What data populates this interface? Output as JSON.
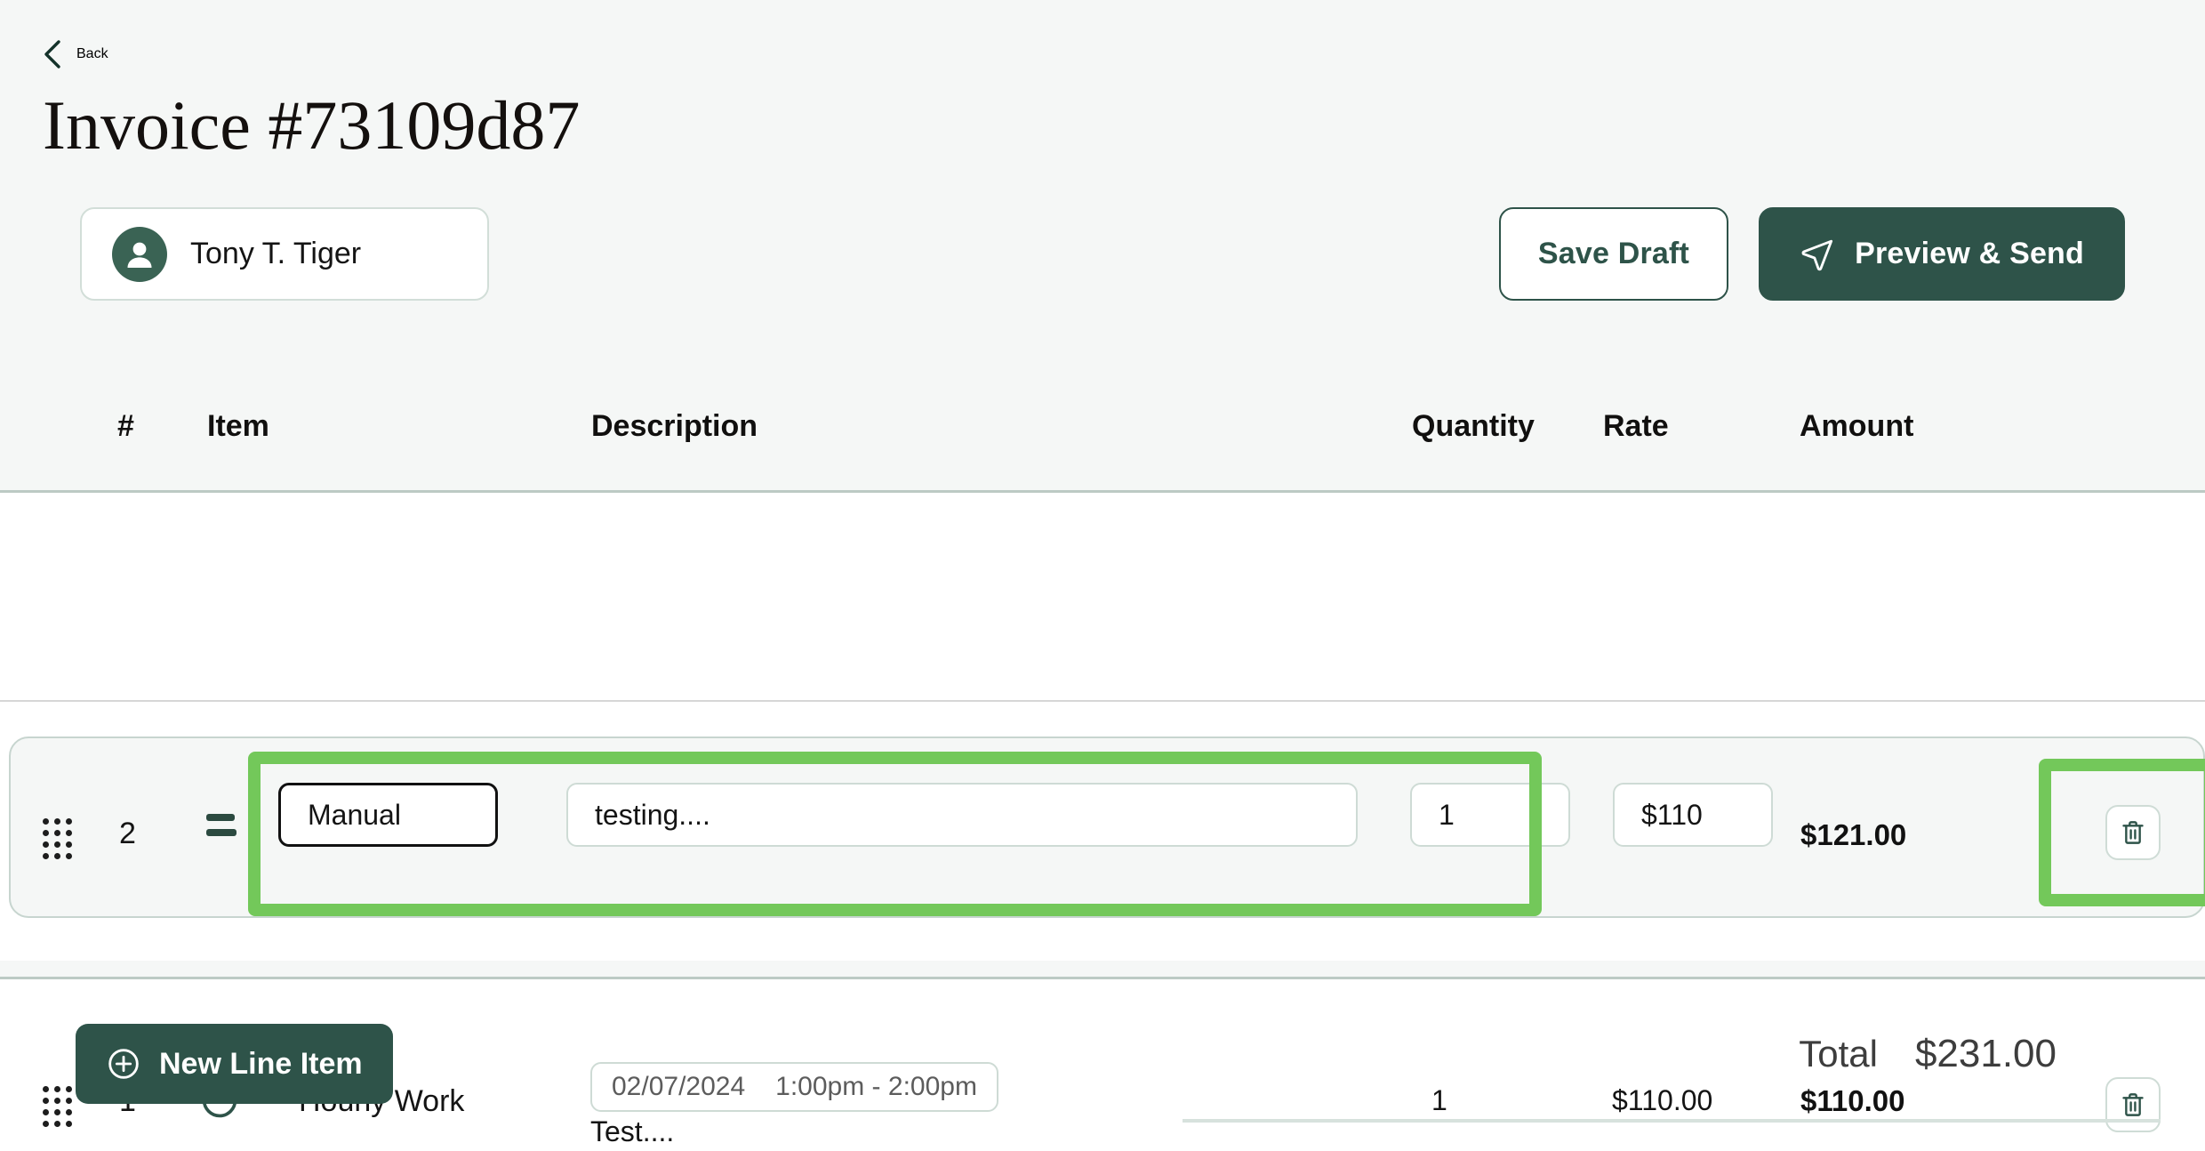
{
  "header": {
    "back_label": "Back",
    "back_icon": "chevron-left-icon",
    "title": "Invoice #73109d87",
    "client": {
      "name": "Tony T. Tiger",
      "avatar_icon": "person-icon"
    },
    "save_draft_label": "Save Draft",
    "preview_send_label": "Preview & Send",
    "preview_send_icon": "send-icon"
  },
  "table": {
    "columns": {
      "number": "#",
      "item": "Item",
      "description": "Description",
      "quantity": "Quantity",
      "rate": "Rate",
      "amount": "Amount"
    },
    "rows": [
      {
        "index": "1",
        "drag_icon": "drag-dots-icon",
        "type_icon": "clock-icon",
        "item": "Hourly Work",
        "date": "02/07/2024",
        "time_range": "1:00pm - 2:00pm",
        "description": "Test....",
        "quantity": "1",
        "rate": "$110.00",
        "amount": "$110.00",
        "delete_icon": "trash-icon"
      },
      {
        "index": "2",
        "drag_icon": "drag-dots-icon",
        "type_icon": "equals-icon",
        "item": "Manual",
        "description": "testing....",
        "quantity": "1",
        "rate": "$110",
        "amount": "$121.00",
        "delete_icon": "trash-icon"
      }
    ]
  },
  "footer": {
    "new_line_item_label": "New Line Item",
    "new_line_item_icon": "plus-circle-icon",
    "total_label": "Total",
    "total_value": "$231.00"
  },
  "colors": {
    "brand_green": "#2e5349",
    "highlight_green": "#73c85a",
    "header_background": "#f5f7f6",
    "border_green_gray": "#cedbd5"
  }
}
